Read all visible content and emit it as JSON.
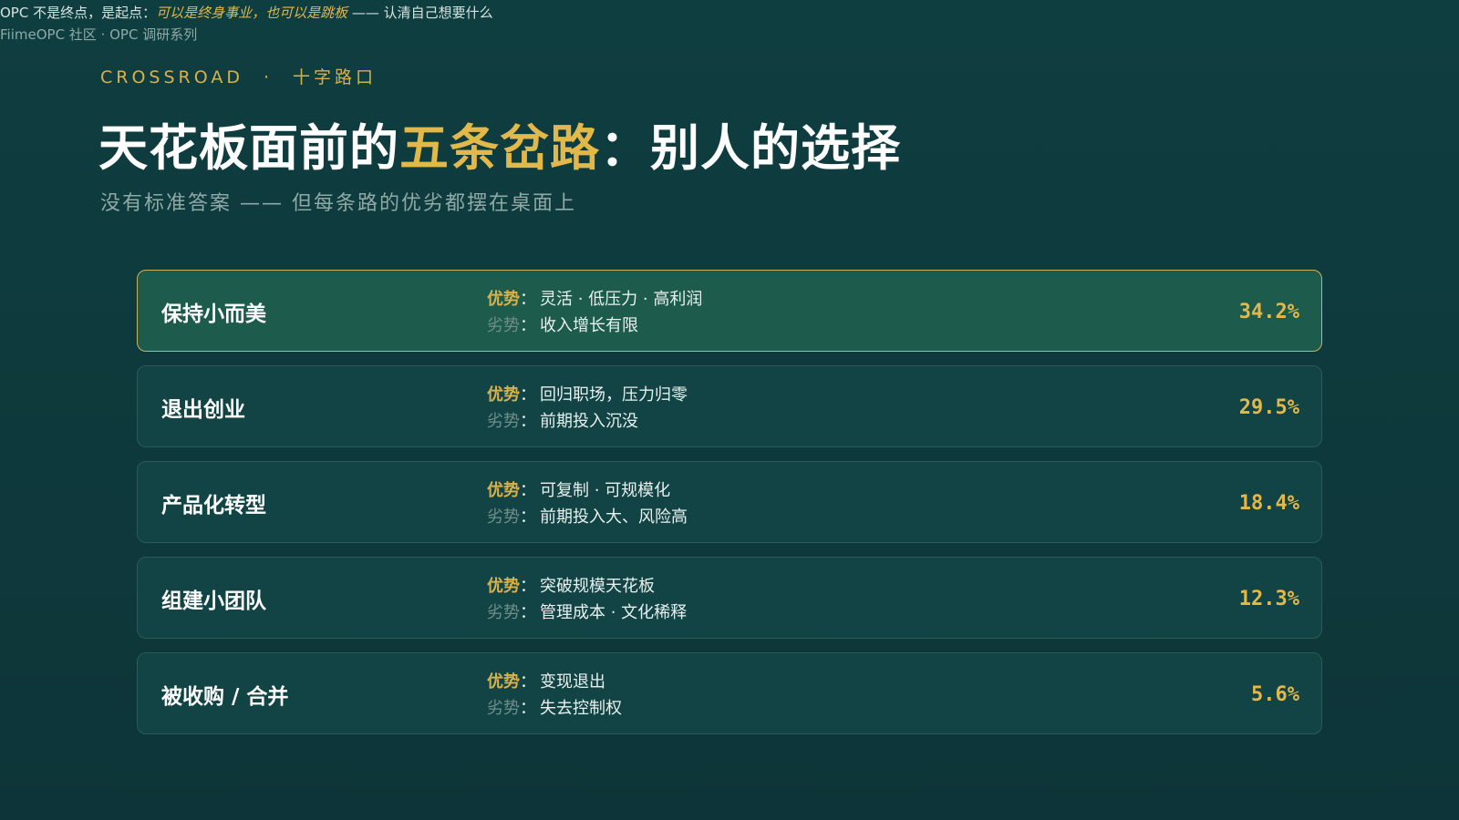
{
  "top_note": {
    "prefix": "OPC 不是终点，是起点：",
    "emphasis": "可以是终身事业，也可以是跳板",
    "suffix": " —— 认清自己想要什么",
    "source": "FiimeOPC 社区 · OPC 调研系列"
  },
  "eyebrow": {
    "left": "CROSSROAD",
    "dot": "·",
    "right": "十字路口"
  },
  "title": {
    "part1": "天花板面前的",
    "highlight": "五条岔路",
    "part2": "：别人的选择"
  },
  "subtitle": "没有标准答案 —— 但每条路的优劣都摆在桌面上",
  "labels": {
    "pro": "优势",
    "con": "劣势",
    "colon": "："
  },
  "paths": [
    {
      "name": "保持小而美",
      "pro": "灵活 · 低压力 · 高利润",
      "con": "收入增长有限",
      "percent": "34.2%"
    },
    {
      "name": "退出创业",
      "pro": "回归职场，压力归零",
      "con": "前期投入沉没",
      "percent": "29.5%"
    },
    {
      "name": "产品化转型",
      "pro": "可复制 · 可规模化",
      "con": "前期投入大、风险高",
      "percent": "18.4%"
    },
    {
      "name": "组建小团队",
      "pro": "突破规模天花板",
      "con": "管理成本 · 文化稀释",
      "percent": "12.3%"
    },
    {
      "name": "被收购 / 合并",
      "pro": "变现退出",
      "con": "失去控制权",
      "percent": "5.6%"
    }
  ],
  "colors": {
    "background": "#0e3a3d",
    "accent_gold": "#e3b84a",
    "featured_card": "#1d5c4c",
    "card": "#124446"
  }
}
